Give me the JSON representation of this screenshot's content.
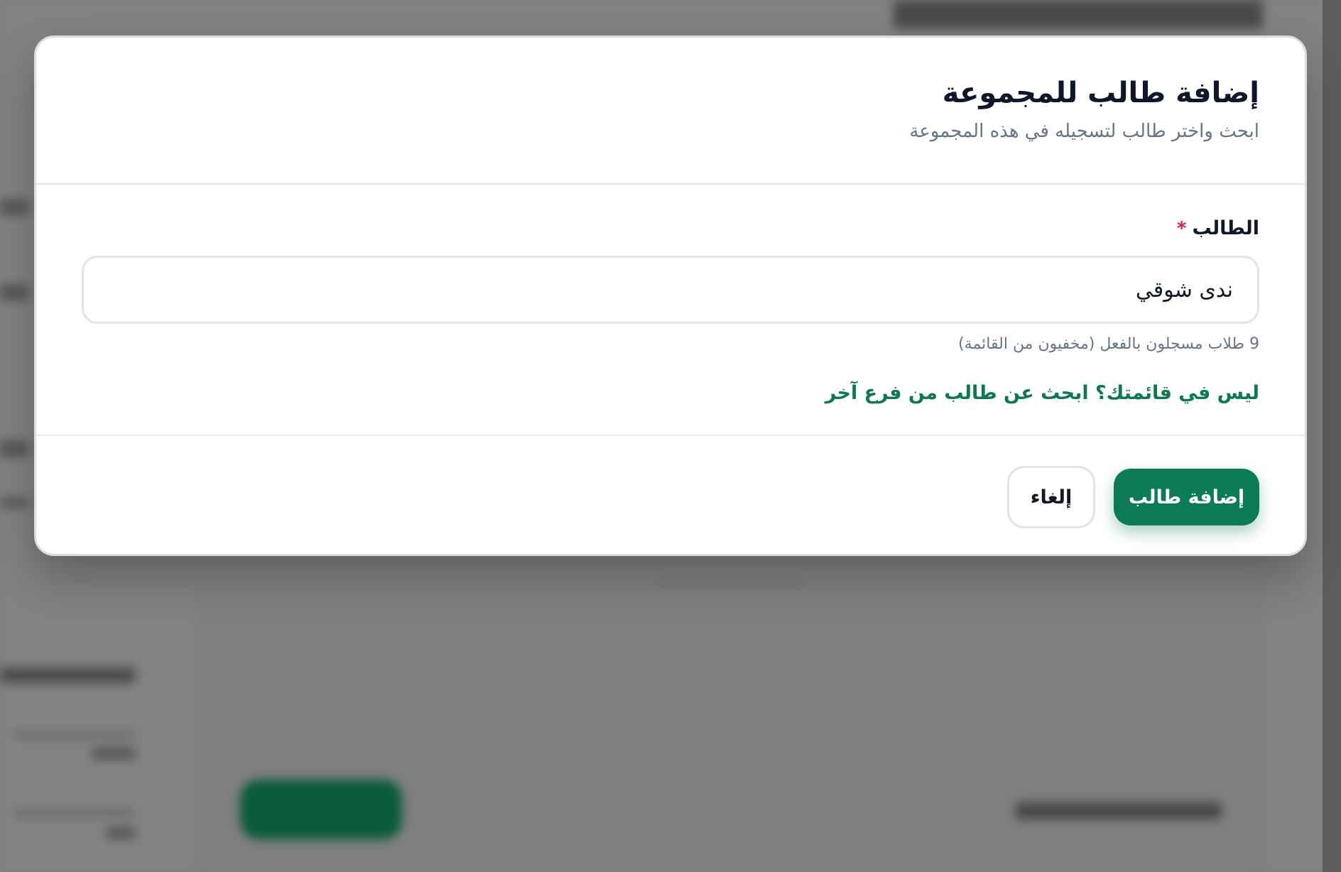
{
  "modal": {
    "title": "إضافة طالب للمجموعة",
    "subtitle": "ابحث واختر طالب لتسجيله في هذه المجموعة",
    "student_field": {
      "label": "الطالب",
      "required_mark": "*",
      "value": "ندى شوقي",
      "hint": "9 طلاب مسجلون بالفعل (مخفيون من القائمة)"
    },
    "other_branch_link": "ليس في قائمتك؟ ابحث عن طالب من فرع آخر",
    "buttons": {
      "cancel": "إلغاء",
      "add": "إضافة طالب"
    }
  },
  "colors": {
    "primary": "#0b7a56",
    "link": "#0b7a4e",
    "required": "#e11d48"
  }
}
